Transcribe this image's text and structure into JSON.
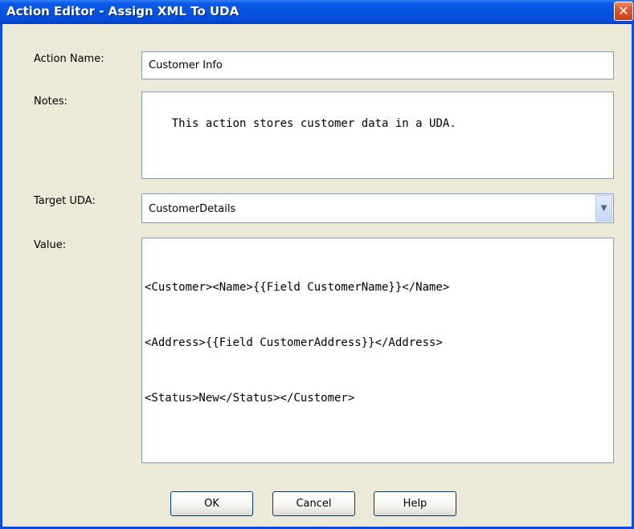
{
  "window": {
    "title": "Action Editor - Assign XML To UDA",
    "close_glyph": "✕"
  },
  "form": {
    "action_name": {
      "label": "Action Name:",
      "value": "Customer Info"
    },
    "notes": {
      "label": "Notes:",
      "value": "This action stores customer data in a UDA."
    },
    "target_uda": {
      "label": "Target UDA:",
      "value": "CustomerDetails",
      "arrow_glyph": "▼"
    },
    "value": {
      "label": "Value:",
      "lines": [
        "<Customer><Name>{{Field CustomerName}}</Name>",
        "<Address>{{Field CustomerAddress}}</Address>",
        "<Status>New</Status></Customer>"
      ]
    }
  },
  "buttons": {
    "ok": "OK",
    "cancel": "Cancel",
    "help": "Help"
  },
  "colors": {
    "titlebar": "#0553e0",
    "dialog_bg": "#ece9d8",
    "close_button": "#d9582c",
    "field_border": "#7f9db9"
  }
}
